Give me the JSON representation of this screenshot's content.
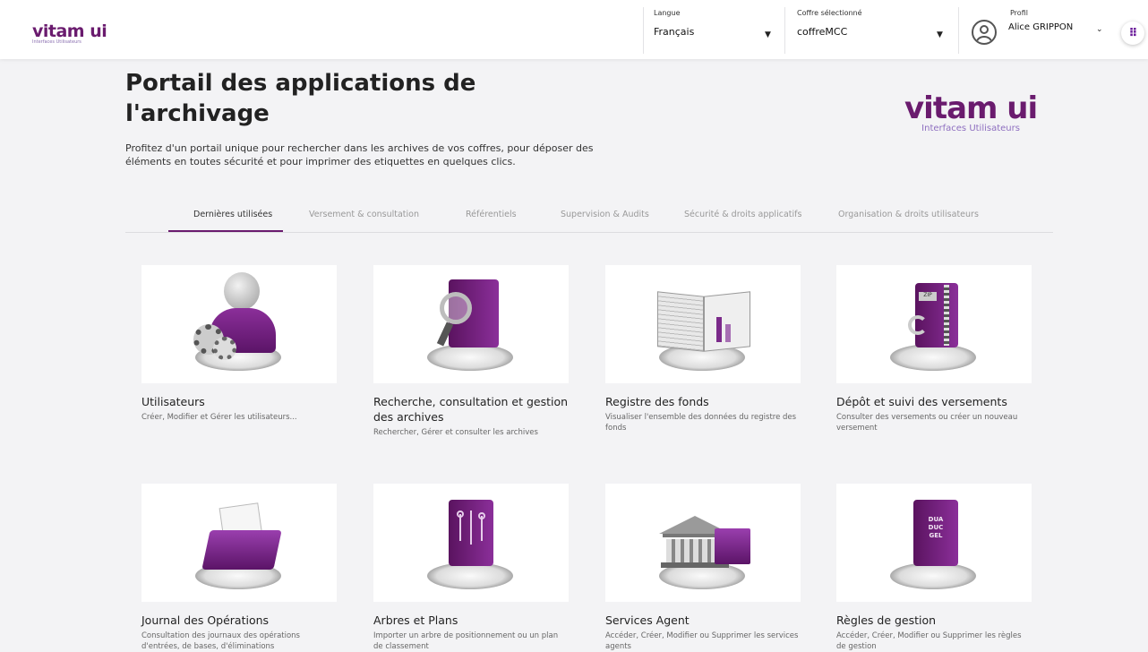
{
  "header": {
    "logo_text": "vitam ui",
    "logo_subtitle": "Interfaces Utilisateurs",
    "language_label": "Langue",
    "language_value": "Français",
    "vault_label": "Coffre sélectionné",
    "vault_value": "coffreMCC",
    "profile_label": "Profil",
    "profile_name": "Alice GRIPPON",
    "apps_icon": "⠿"
  },
  "hero": {
    "title": "Portail des applications de l'archivage",
    "description": "Profitez d'un portail unique pour rechercher dans les archives de vos coffres, pour déposer des éléments en toutes sécurité et pour imprimer des etiquettes en quelques clics.",
    "logo_text": "vitam ui",
    "logo_subtitle": "Interfaces Utilisateurs"
  },
  "tabs": [
    {
      "label": "Dernières utilisées"
    },
    {
      "label": "Versement & consultation"
    },
    {
      "label": "Référentiels"
    },
    {
      "label": "Supervision & Audits"
    },
    {
      "label": "Sécurité & droits applicatifs"
    },
    {
      "label": "Organisation & droits utilisateurs"
    }
  ],
  "cards": [
    {
      "title": "Utilisateurs",
      "description": "Créer, Modifier et Gérer les utilisateurs...",
      "icon": "users-gears-icon"
    },
    {
      "title": "Recherche, consultation et gestion des archives",
      "description": "Rechercher, Gérer et consulter les archives",
      "icon": "archive-search-icon"
    },
    {
      "title": "Registre des fonds",
      "description": "Visualiser l'ensemble des données du registre des fonds",
      "icon": "register-book-icon"
    },
    {
      "title": "Dépôt et suivi des versements",
      "description": "Consulter des versements ou créer un nouveau versement",
      "icon": "zip-deposit-icon"
    },
    {
      "title": "Journal des Opérations",
      "description": "Consultation des journaux des opérations d'entrées, de bases, d'éliminations",
      "icon": "operations-folder-icon"
    },
    {
      "title": "Arbres et Plans",
      "description": "Importer un arbre de positionnement ou un plan de classement",
      "icon": "tree-circuit-icon"
    },
    {
      "title": "Services Agent",
      "description": "Accéder, Créer, Modifier ou Supprimer les services agents",
      "icon": "agency-building-icon"
    },
    {
      "title": "Règles de gestion",
      "description": "Accéder, Créer, Modifier ou Supprimer les règles de gestion",
      "icon": "rules-book-icon",
      "icon_text": "DUA DUC GEL"
    }
  ]
}
